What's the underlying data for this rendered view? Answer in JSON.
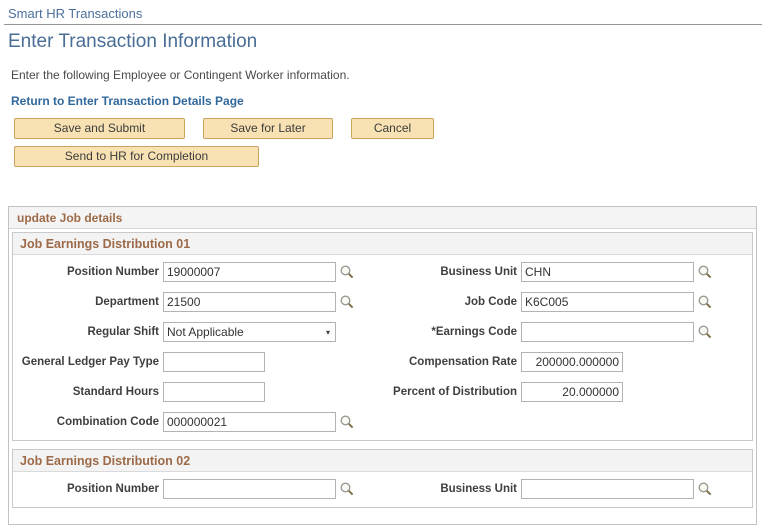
{
  "page": {
    "breadcrumb": "Smart HR Transactions",
    "title": "Enter Transaction Information",
    "description": "Enter the following Employee or Contingent Worker information.",
    "return_link": "Return to Enter Transaction Details Page"
  },
  "toolbar": {
    "save_and_submit": "Save and Submit",
    "save_for_later": "Save for Later",
    "cancel": "Cancel",
    "send_to_hr": "Send to HR for Completion"
  },
  "groupbox": {
    "title": "update Job details",
    "section1": {
      "title": "Job Earnings Distribution 01",
      "fields": {
        "position_number": {
          "label": "Position Number",
          "value": "19000007"
        },
        "business_unit": {
          "label": "Business Unit",
          "value": "CHN"
        },
        "department": {
          "label": "Department",
          "value": "21500"
        },
        "job_code": {
          "label": "Job Code",
          "value": "K6C005"
        },
        "regular_shift": {
          "label": "Regular Shift",
          "value": "Not Applicable"
        },
        "earnings_code": {
          "label": "*Earnings Code",
          "value": ""
        },
        "gl_pay_type": {
          "label": "General Ledger Pay Type",
          "value": ""
        },
        "compensation_rate": {
          "label": "Compensation Rate",
          "value": "200000.000000"
        },
        "standard_hours": {
          "label": "Standard Hours",
          "value": ""
        },
        "percent_of_distribution": {
          "label": "Percent of Distribution",
          "value": "20.000000"
        },
        "combination_code": {
          "label": "Combination Code",
          "value": "000000021"
        }
      }
    },
    "section2": {
      "title": "Job Earnings Distribution 02",
      "fields": {
        "position_number": {
          "label": "Position Number",
          "value": ""
        },
        "business_unit": {
          "label": "Business Unit",
          "value": ""
        }
      }
    }
  },
  "icons": {
    "lookup": "magnifier-lookup-icon",
    "dropdown_arrow": "▾"
  },
  "colors": {
    "title_blue": "#4a6d96",
    "link_blue": "#31689b",
    "section_brown": "#9c6a48",
    "button_bg": "#f8e2b3",
    "button_border": "#c9a45f"
  }
}
